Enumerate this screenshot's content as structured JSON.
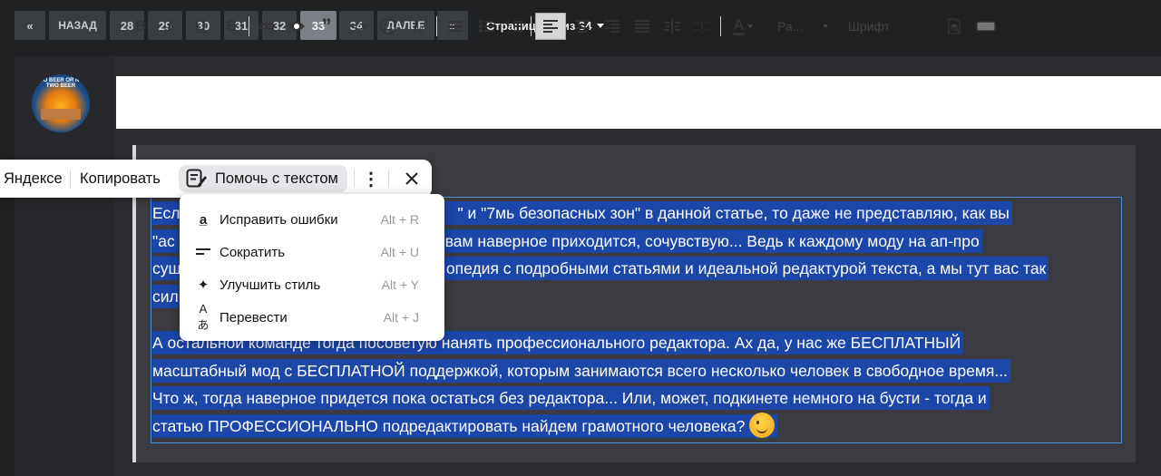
{
  "pagination": {
    "first": "«",
    "prev": "НАЗАД",
    "pages": [
      "28",
      "29",
      "30",
      "31",
      "32",
      "33",
      "34"
    ],
    "current": "33",
    "next": "ДАЛЕЕ",
    "last": "»",
    "page_of": "Страница 33 из 34"
  },
  "avatar": {
    "text": "TWO BEER OR NOT TWO BEER"
  },
  "toolbar": {
    "bold": "B",
    "italic": "I",
    "underline": "U",
    "strike": "S",
    "font_size": "Ра...",
    "font_family": "Шрифт"
  },
  "popup": {
    "yandex": "Яндексе",
    "copy": "Копировать",
    "help": "Помочь с текстом"
  },
  "menu": {
    "items": [
      {
        "label": "Исправить ошибки",
        "shortcut": "Alt + R",
        "icon": "spellcheck-icon"
      },
      {
        "label": "Сократить",
        "shortcut": "Alt + U",
        "icon": "shorten-icon"
      },
      {
        "label": "Улучшить стиль",
        "shortcut": "Alt + Y",
        "icon": "sparkle-icon"
      },
      {
        "label": "Перевести",
        "shortcut": "Alt + J",
        "icon": "translate-icon"
      }
    ]
  },
  "editor": {
    "lines_p1": [
      "Есл",
      "\" и \"7мь безопасных зон\" в данной статье, то даже не представляю, как вы",
      "\"ас",
      "вам наверное приходится, сочувствую... Ведь к каждому моду на ап-про",
      "сущ",
      "опедия с подробными статьями и идеальной редактурой текста, а мы тут вас так",
      "сил"
    ],
    "lines_p2": [
      "А остальной команде тогда посоветую нанять профессионального редактора. Ах да, у нас же БЕСПЛАТНЫЙ",
      "масштабный мод с БЕСПЛАТНОЙ поддержкой, которым занимаются всего несколько человек в свободное время...",
      "Что ж, тогда наверное придется пока остаться без редактора... Или, может, подкинете немного на бусти - тогда и",
      "статью ПРОФЕССИОНАЛЬНО подредактировать найдем грамотного человека?"
    ]
  },
  "colors": {
    "selection": "#1c46a8",
    "selection_border": "#4f8fde",
    "page_bg": "#202123",
    "button_bg": "#3a3d42",
    "button_active": "#7b7f86"
  }
}
